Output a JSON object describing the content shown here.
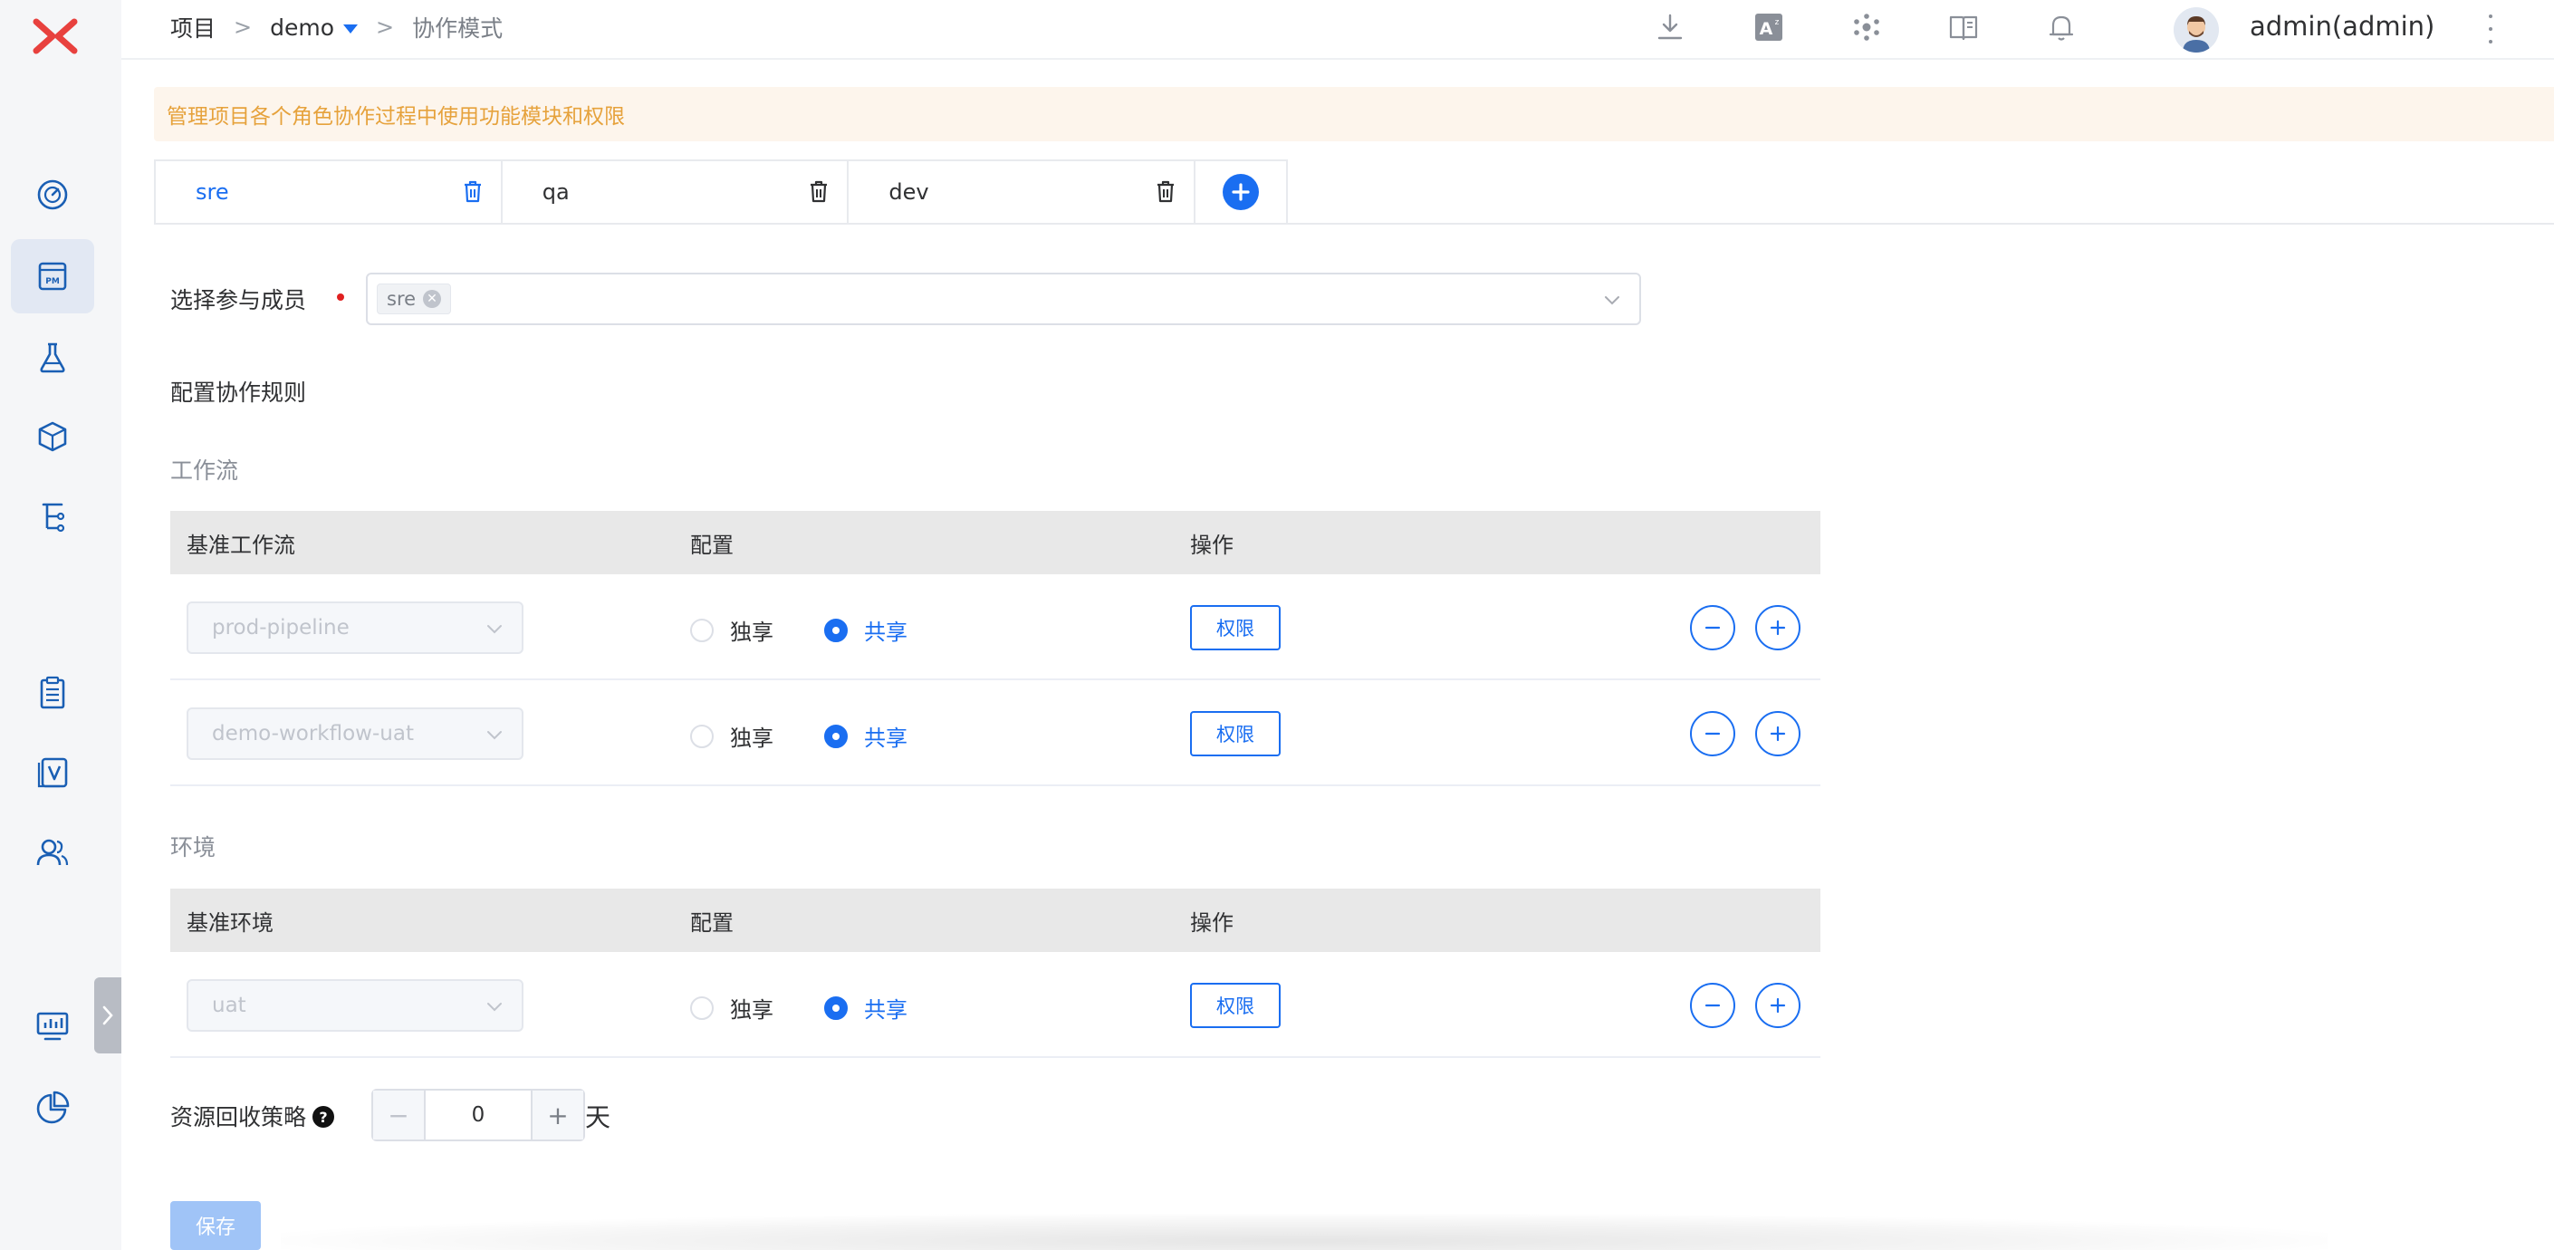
{
  "breadcrumb": {
    "root": "项目",
    "project": "demo",
    "current": "协作模式",
    "separator": ">"
  },
  "header": {
    "icons": [
      "download-icon",
      "translate-icon",
      "network-icon",
      "book-icon",
      "bell-icon"
    ],
    "user_name": "admin(admin)"
  },
  "sidebar": {
    "items": [
      "dashboard-icon",
      "project-icon",
      "testing-icon",
      "artifact-icon",
      "tree-icon",
      "clipboard-icon",
      "version-icon",
      "users-icon",
      "monitor-icon",
      "pie-chart-icon"
    ],
    "active_item": "project-icon"
  },
  "notice": "管理项目各个角色协作过程中使用功能模块和权限",
  "tabs": [
    {
      "label": "sre",
      "active": true
    },
    {
      "label": "qa",
      "active": false
    },
    {
      "label": "dev",
      "active": false
    }
  ],
  "members": {
    "label": "选择参与成员",
    "selected": [
      "sre"
    ]
  },
  "rules_title": "配置协作规则",
  "workflow": {
    "title": "工作流",
    "headers": [
      "基准工作流",
      "配置",
      "操作"
    ],
    "rows": [
      {
        "name": "prod-pipeline",
        "exclusive": "独享",
        "shared": "共享",
        "selected": "shared",
        "perm": "权限"
      },
      {
        "name": "demo-workflow-uat",
        "exclusive": "独享",
        "shared": "共享",
        "selected": "shared",
        "perm": "权限"
      }
    ]
  },
  "environment": {
    "title": "环境",
    "headers": [
      "基准环境",
      "配置",
      "操作"
    ],
    "rows": [
      {
        "name": "uat",
        "exclusive": "独享",
        "shared": "共享",
        "selected": "shared",
        "perm": "权限"
      }
    ]
  },
  "recycle": {
    "label": "资源回收策略",
    "value": "0",
    "unit": "天"
  },
  "save_label": "保存",
  "colors": {
    "accent": "#1a6ef1",
    "notice_bg": "#fdf5ec",
    "notice_text": "#e6a23c",
    "logo": "#e8413e"
  }
}
